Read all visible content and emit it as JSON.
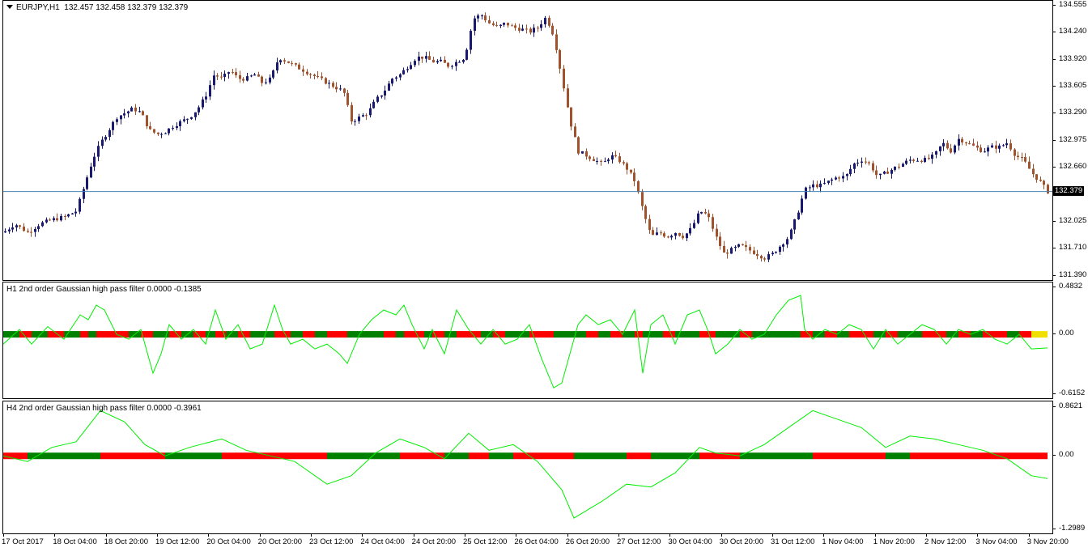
{
  "main": {
    "symbol": "EURJPY,H1",
    "ohlc": "132.457 132.458 132.379 132.379",
    "current_price": "132.379",
    "price_levels": [
      "134.555",
      "134.240",
      "133.920",
      "133.605",
      "133.290",
      "132.975",
      "132.660",
      "132.379",
      "132.025",
      "131.710",
      "131.390"
    ]
  },
  "h1": {
    "title": "H1 2nd order Gaussian high pass filter 0.0000 -0.1385",
    "levels": [
      "0.4832",
      "0.00",
      "-0.6152"
    ]
  },
  "h4": {
    "title": "H4 2nd order Gaussian high pass filter 0.0000 -0.3961",
    "levels": [
      "0.8621",
      "0.00",
      "-1.2989"
    ]
  },
  "time_labels": [
    "17 Oct 2017",
    "18 Oct 04:00",
    "18 Oct 20:00",
    "19 Oct 12:00",
    "20 Oct 04:00",
    "20 Oct 20:00",
    "23 Oct 12:00",
    "24 Oct 04:00",
    "24 Oct 20:00",
    "25 Oct 12:00",
    "26 Oct 04:00",
    "26 Oct 20:00",
    "27 Oct 12:00",
    "30 Oct 04:00",
    "30 Oct 20:00",
    "31 Oct 12:00",
    "1 Nov 04:00",
    "1 Nov 20:00",
    "2 Nov 12:00",
    "3 Nov 04:00",
    "3 Nov 20:00"
  ],
  "colors": {
    "bull": "#191970",
    "bear": "#a0522d",
    "line": "#00ee00",
    "bar_green": "#008000",
    "bar_red": "#ff0000",
    "bar_yellow": "#f0e000",
    "price_line": "#4682b4"
  },
  "chart_data": [
    {
      "type": "candlestick",
      "title": "EURJPY,H1",
      "ylim": [
        131.39,
        134.555
      ],
      "close_path": [
        [
          0,
          131.9
        ],
        [
          14,
          132.0
        ],
        [
          22,
          131.95
        ],
        [
          30,
          131.9
        ],
        [
          45,
          132.0
        ],
        [
          60,
          132.05
        ],
        [
          75,
          132.08
        ],
        [
          90,
          132.15
        ],
        [
          100,
          132.45
        ],
        [
          110,
          132.75
        ],
        [
          120,
          132.95
        ],
        [
          130,
          133.1
        ],
        [
          140,
          133.25
        ],
        [
          150,
          133.3
        ],
        [
          160,
          133.35
        ],
        [
          170,
          133.3
        ],
        [
          180,
          133.1
        ],
        [
          190,
          133.05
        ],
        [
          200,
          133.08
        ],
        [
          210,
          133.15
        ],
        [
          220,
          133.2
        ],
        [
          230,
          133.25
        ],
        [
          240,
          133.35
        ],
        [
          250,
          133.5
        ],
        [
          260,
          133.75
        ],
        [
          270,
          133.7
        ],
        [
          280,
          133.8
        ],
        [
          290,
          133.7
        ],
        [
          300,
          133.7
        ],
        [
          310,
          133.75
        ],
        [
          320,
          133.65
        ],
        [
          330,
          133.7
        ],
        [
          340,
          133.95
        ],
        [
          350,
          133.9
        ],
        [
          360,
          133.85
        ],
        [
          370,
          133.8
        ],
        [
          380,
          133.75
        ],
        [
          390,
          133.7
        ],
        [
          400,
          133.65
        ],
        [
          410,
          133.6
        ],
        [
          420,
          133.55
        ],
        [
          430,
          133.2
        ],
        [
          440,
          133.25
        ],
        [
          450,
          133.3
        ],
        [
          460,
          133.45
        ],
        [
          470,
          133.55
        ],
        [
          480,
          133.7
        ],
        [
          490,
          133.75
        ],
        [
          500,
          133.85
        ],
        [
          510,
          133.95
        ],
        [
          520,
          133.95
        ],
        [
          530,
          133.9
        ],
        [
          540,
          133.9
        ],
        [
          550,
          133.85
        ],
        [
          560,
          133.9
        ],
        [
          570,
          133.95
        ],
        [
          580,
          134.4
        ],
        [
          590,
          134.45
        ],
        [
          600,
          134.35
        ],
        [
          610,
          134.3
        ],
        [
          620,
          134.35
        ],
        [
          630,
          134.3
        ],
        [
          640,
          134.28
        ],
        [
          650,
          134.25
        ],
        [
          660,
          134.3
        ],
        [
          670,
          134.42
        ],
        [
          680,
          134.2
        ],
        [
          690,
          133.7
        ],
        [
          700,
          133.2
        ],
        [
          710,
          132.85
        ],
        [
          720,
          132.8
        ],
        [
          730,
          132.75
        ],
        [
          740,
          132.7
        ],
        [
          750,
          132.8
        ],
        [
          760,
          132.75
        ],
        [
          770,
          132.65
        ],
        [
          780,
          132.5
        ],
        [
          790,
          132.15
        ],
        [
          800,
          131.85
        ],
        [
          810,
          131.9
        ],
        [
          820,
          131.85
        ],
        [
          830,
          131.9
        ],
        [
          840,
          131.85
        ],
        [
          850,
          131.95
        ],
        [
          860,
          132.15
        ],
        [
          870,
          132.1
        ],
        [
          880,
          131.85
        ],
        [
          890,
          131.65
        ],
        [
          900,
          131.7
        ],
        [
          910,
          131.75
        ],
        [
          920,
          131.7
        ],
        [
          930,
          131.65
        ],
        [
          940,
          131.6
        ],
        [
          950,
          131.65
        ],
        [
          960,
          131.75
        ],
        [
          970,
          131.85
        ],
        [
          980,
          132.1
        ],
        [
          990,
          132.4
        ],
        [
          1000,
          132.45
        ],
        [
          1010,
          132.45
        ],
        [
          1020,
          132.5
        ],
        [
          1030,
          132.55
        ],
        [
          1040,
          132.55
        ],
        [
          1050,
          132.7
        ],
        [
          1060,
          132.75
        ],
        [
          1070,
          132.7
        ],
        [
          1080,
          132.55
        ],
        [
          1090,
          132.6
        ],
        [
          1100,
          132.65
        ],
        [
          1110,
          132.7
        ],
        [
          1120,
          132.75
        ],
        [
          1130,
          132.75
        ],
        [
          1140,
          132.75
        ],
        [
          1150,
          132.8
        ],
        [
          1160,
          132.95
        ],
        [
          1170,
          132.85
        ],
        [
          1180,
          133.0
        ],
        [
          1190,
          132.95
        ],
        [
          1200,
          132.9
        ],
        [
          1210,
          132.85
        ],
        [
          1220,
          132.9
        ],
        [
          1230,
          132.9
        ],
        [
          1240,
          132.95
        ],
        [
          1250,
          132.8
        ],
        [
          1260,
          132.75
        ],
        [
          1270,
          132.6
        ],
        [
          1280,
          132.5
        ],
        [
          1290,
          132.379
        ]
      ]
    },
    {
      "type": "line",
      "title": "H1 2nd order Gaussian high pass filter 0.0000 -0.1385",
      "ylim": [
        -0.6152,
        0.4832
      ],
      "x": [
        0,
        20,
        35,
        55,
        75,
        95,
        105,
        115,
        125,
        140,
        155,
        170,
        185,
        195,
        205,
        220,
        235,
        250,
        262,
        275,
        290,
        305,
        320,
        335,
        345,
        355,
        370,
        385,
        400,
        415,
        425,
        440,
        455,
        470,
        485,
        495,
        505,
        520,
        530,
        545,
        560,
        575,
        590,
        605,
        620,
        635,
        650,
        665,
        680,
        690,
        700,
        710,
        720,
        735,
        750,
        765,
        780,
        790,
        800,
        815,
        830,
        845,
        860,
        870,
        880,
        895,
        910,
        925,
        940,
        955,
        970,
        985,
        990,
        1000,
        1015,
        1030,
        1045,
        1060,
        1075,
        1090,
        1105,
        1120,
        1135,
        1150,
        1165,
        1180,
        1195,
        1210,
        1225,
        1240,
        1255,
        1270,
        1290
      ],
      "values": [
        -0.1,
        0.05,
        -0.1,
        0.08,
        -0.05,
        0.2,
        0.15,
        0.3,
        0.25,
        0.0,
        -0.05,
        0.05,
        -0.4,
        -0.2,
        0.1,
        -0.05,
        0.05,
        -0.1,
        0.25,
        -0.05,
        0.1,
        -0.15,
        -0.1,
        0.3,
        0.05,
        -0.1,
        -0.05,
        -0.15,
        -0.1,
        -0.2,
        -0.3,
        0.0,
        0.15,
        0.25,
        0.2,
        0.3,
        0.1,
        -0.15,
        0.05,
        -0.2,
        0.25,
        0.05,
        -0.1,
        0.05,
        -0.1,
        -0.05,
        0.1,
        -0.25,
        -0.55,
        -0.5,
        -0.2,
        0.1,
        0.2,
        0.1,
        0.15,
        0.0,
        0.25,
        -0.4,
        0.1,
        0.2,
        -0.1,
        0.2,
        0.25,
        0.05,
        -0.2,
        -0.1,
        0.05,
        -0.05,
        0.0,
        0.2,
        0.35,
        0.4,
        0.05,
        -0.05,
        0.05,
        0.0,
        0.1,
        0.05,
        -0.15,
        0.05,
        -0.1,
        0.0,
        0.1,
        0.05,
        -0.1,
        0.05,
        0.0,
        0.05,
        -0.05,
        -0.1,
        0.0,
        -0.15,
        -0.14
      ]
    },
    {
      "type": "line",
      "title": "H4 2nd order Gaussian high pass filter 0.0000 -0.3961",
      "ylim": [
        -1.2989,
        0.8621
      ],
      "x": [
        0,
        30,
        60,
        90,
        120,
        150,
        175,
        200,
        230,
        270,
        300,
        330,
        360,
        400,
        430,
        460,
        490,
        520,
        545,
        575,
        600,
        630,
        660,
        690,
        705,
        740,
        770,
        800,
        830,
        860,
        880,
        910,
        940,
        970,
        1000,
        1030,
        1060,
        1090,
        1120,
        1150,
        1180,
        1210,
        1240,
        1270,
        1290
      ],
      "values": [
        0.0,
        -0.1,
        0.15,
        0.25,
        0.8,
        0.6,
        0.2,
        0.0,
        0.15,
        0.3,
        0.1,
        0.0,
        -0.1,
        -0.5,
        -0.35,
        0.05,
        0.3,
        0.15,
        -0.05,
        0.4,
        0.1,
        0.2,
        -0.1,
        -0.6,
        -1.1,
        -0.8,
        -0.5,
        -0.55,
        -0.3,
        0.15,
        0.05,
        0.0,
        0.2,
        0.5,
        0.8,
        0.65,
        0.5,
        0.15,
        0.35,
        0.3,
        0.2,
        0.1,
        -0.05,
        -0.35,
        -0.4
      ]
    }
  ]
}
